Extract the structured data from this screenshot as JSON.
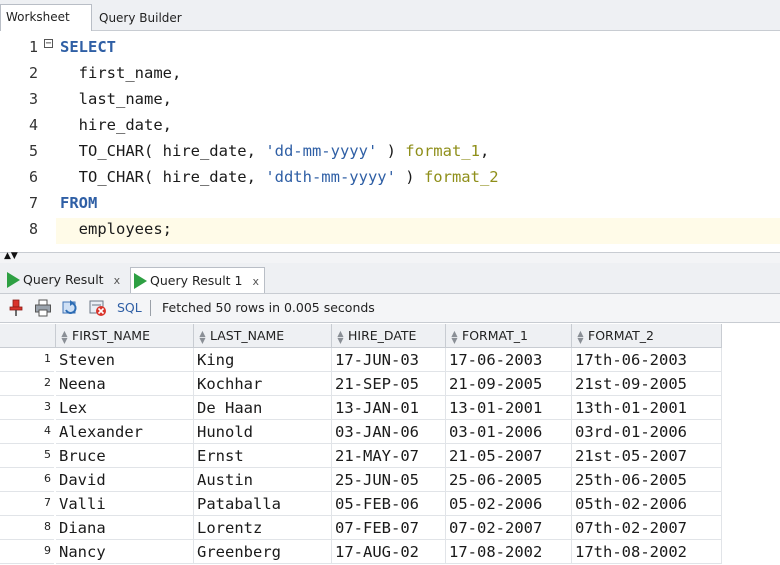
{
  "top_tabs": [
    {
      "label": "Worksheet"
    },
    {
      "label": "Query Builder"
    }
  ],
  "editor": {
    "line_numbers": [
      "1",
      "2",
      "3",
      "4",
      "5",
      "6",
      "7",
      "8"
    ],
    "lines": [
      [
        {
          "t": "SELECT",
          "c": "kw"
        }
      ],
      [
        {
          "t": "  first_name,",
          "c": ""
        }
      ],
      [
        {
          "t": "  last_name,",
          "c": ""
        }
      ],
      [
        {
          "t": "  hire_date,",
          "c": ""
        }
      ],
      [
        {
          "t": "  TO_CHAR( hire_date, ",
          "c": ""
        },
        {
          "t": "'dd-mm-yyyy'",
          "c": "str"
        },
        {
          "t": " ) ",
          "c": ""
        },
        {
          "t": "format_1",
          "c": "alias"
        },
        {
          "t": ",",
          "c": ""
        }
      ],
      [
        {
          "t": "  TO_CHAR( hire_date, ",
          "c": ""
        },
        {
          "t": "'ddth-mm-yyyy'",
          "c": "str"
        },
        {
          "t": " ) ",
          "c": ""
        },
        {
          "t": "format_2",
          "c": "alias"
        }
      ],
      [
        {
          "t": "FROM",
          "c": "kw"
        }
      ],
      [
        {
          "t": "  employees;",
          "c": ""
        }
      ]
    ],
    "fold_symbol": "−"
  },
  "result_tabs": [
    {
      "label": "Query Result",
      "close": "x"
    },
    {
      "label": "Query Result 1",
      "close": "x"
    }
  ],
  "toolbar": {
    "icons": [
      "pin-icon",
      "print-icon",
      "refresh-icon",
      "cancel-icon"
    ],
    "sql_label": "SQL",
    "status": "Fetched 50 rows in 0.005 seconds"
  },
  "grid": {
    "columns": [
      "FIRST_NAME",
      "LAST_NAME",
      "HIRE_DATE",
      "FORMAT_1",
      "FORMAT_2"
    ],
    "rows": [
      {
        "num": "1",
        "cells": [
          "Steven",
          "King",
          "17-JUN-03",
          "17-06-2003",
          "17th-06-2003"
        ]
      },
      {
        "num": "2",
        "cells": [
          "Neena",
          "Kochhar",
          "21-SEP-05",
          "21-09-2005",
          "21st-09-2005"
        ]
      },
      {
        "num": "3",
        "cells": [
          "Lex",
          "De Haan",
          "13-JAN-01",
          "13-01-2001",
          "13th-01-2001"
        ]
      },
      {
        "num": "4",
        "cells": [
          "Alexander",
          "Hunold",
          "03-JAN-06",
          "03-01-2006",
          "03rd-01-2006"
        ]
      },
      {
        "num": "5",
        "cells": [
          "Bruce",
          "Ernst",
          "21-MAY-07",
          "21-05-2007",
          "21st-05-2007"
        ]
      },
      {
        "num": "6",
        "cells": [
          "David",
          "Austin",
          "25-JUN-05",
          "25-06-2005",
          "25th-06-2005"
        ]
      },
      {
        "num": "7",
        "cells": [
          "Valli",
          "Pataballa",
          "05-FEB-06",
          "05-02-2006",
          "05th-02-2006"
        ]
      },
      {
        "num": "8",
        "cells": [
          "Diana",
          "Lorentz",
          "07-FEB-07",
          "07-02-2007",
          "07th-02-2007"
        ]
      },
      {
        "num": "9",
        "cells": [
          "Nancy",
          "Greenberg",
          "17-AUG-02",
          "17-08-2002",
          "17th-08-2002"
        ]
      }
    ]
  }
}
